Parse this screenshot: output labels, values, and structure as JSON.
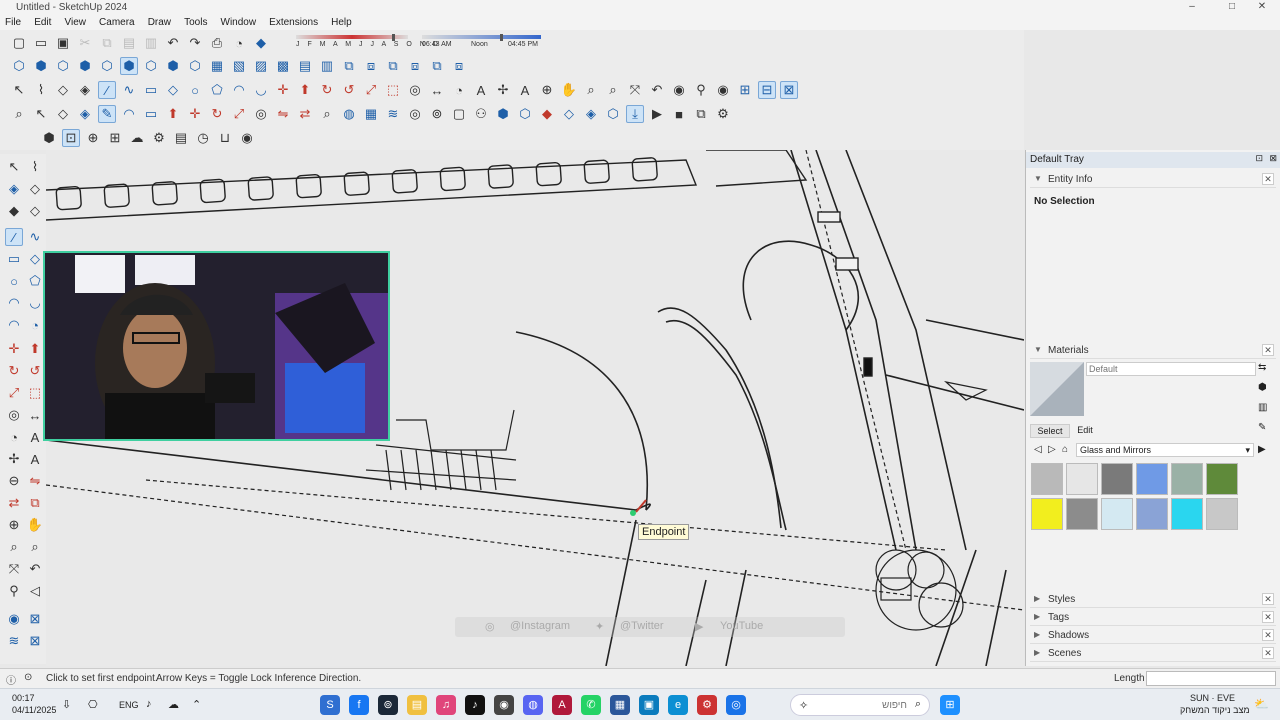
{
  "window": {
    "title": "Untitled - SketchUp 2024",
    "minimize": "–",
    "maximize": "□",
    "close": "✕"
  },
  "menu": [
    "File",
    "Edit",
    "View",
    "Camera",
    "Draw",
    "Tools",
    "Window",
    "Extensions",
    "Help"
  ],
  "shadow_bar": {
    "months": "J F M A M J J A S O N D",
    "time_start": "06:43 AM",
    "time_mid": "Noon",
    "time_end": "04:45 PM"
  },
  "canvas": {
    "inference_tooltip": "Endpoint",
    "social": {
      "instagram": "@Instagram",
      "twitter": "@Twitter",
      "youtube": "YouTube"
    }
  },
  "tray": {
    "title": "Default Tray",
    "entity_info": {
      "heading": "Entity Info",
      "value": "No Selection"
    },
    "materials": {
      "heading": "Materials",
      "name_placeholder": "Default",
      "tab_select": "Select",
      "tab_edit": "Edit",
      "collection": "Glass and Mirrors",
      "swatches": [
        "#b9b9b9",
        "#e6e6e6",
        "#7a7a7a",
        "#6f9ae6",
        "#9ab1a6",
        "#5f8a3a",
        "#f2ee1e",
        "#8c8c8c",
        "#d4e9f2",
        "#8aa3d6",
        "#2ad6ef",
        "#c8c8c8"
      ]
    },
    "collapsed_sections": [
      "Styles",
      "Tags",
      "Shadows",
      "Scenes"
    ]
  },
  "status": {
    "hint1": "Click to set first endpoint.",
    "hint2": "Arrow Keys = Toggle Lock Inference Direction.",
    "measure_label": "Length",
    "measure_value": ""
  },
  "taskbar": {
    "time": "00:17",
    "date": "04/11/2025",
    "lang": "ENG",
    "search_placeholder": "חיפוש",
    "weather_line1": "SUN · EVE",
    "weather_line2": "מצב ניקוד המשחק"
  }
}
